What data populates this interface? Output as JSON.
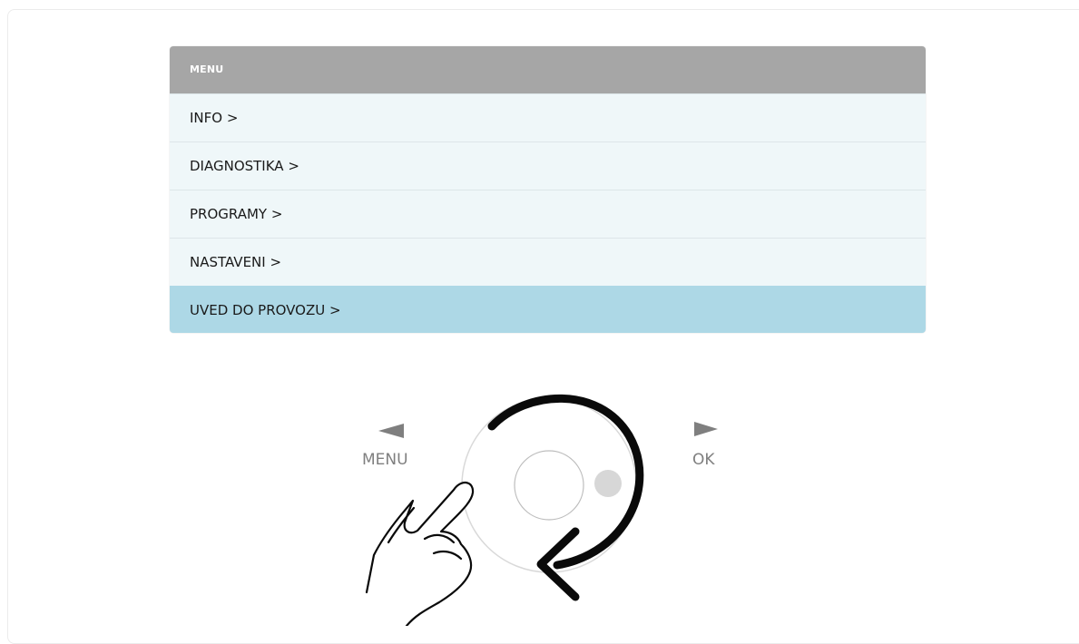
{
  "menu": {
    "header": "MENU",
    "items": [
      {
        "label": "INFO >",
        "selected": false
      },
      {
        "label": "DIAGNOSTIKA >",
        "selected": false
      },
      {
        "label": "PROGRAMY >",
        "selected": false
      },
      {
        "label": "NASTAVENI >",
        "selected": false
      },
      {
        "label": "UVED DO PROVOZU >",
        "selected": true
      }
    ]
  },
  "controls": {
    "left_label": "MENU",
    "right_label": "OK",
    "left_icon": "left-triangle-icon",
    "right_icon": "right-triangle-icon",
    "dial_icon": "rotary-dial-icon",
    "rotate_icon": "rotate-clockwise-arrow-icon",
    "hand_icon": "pointing-hand-icon"
  },
  "colors": {
    "header_bg": "#a6a6a6",
    "item_bg": "#eff7f9",
    "selected_bg": "#add8e6",
    "control_label": "#7f7f7f"
  }
}
